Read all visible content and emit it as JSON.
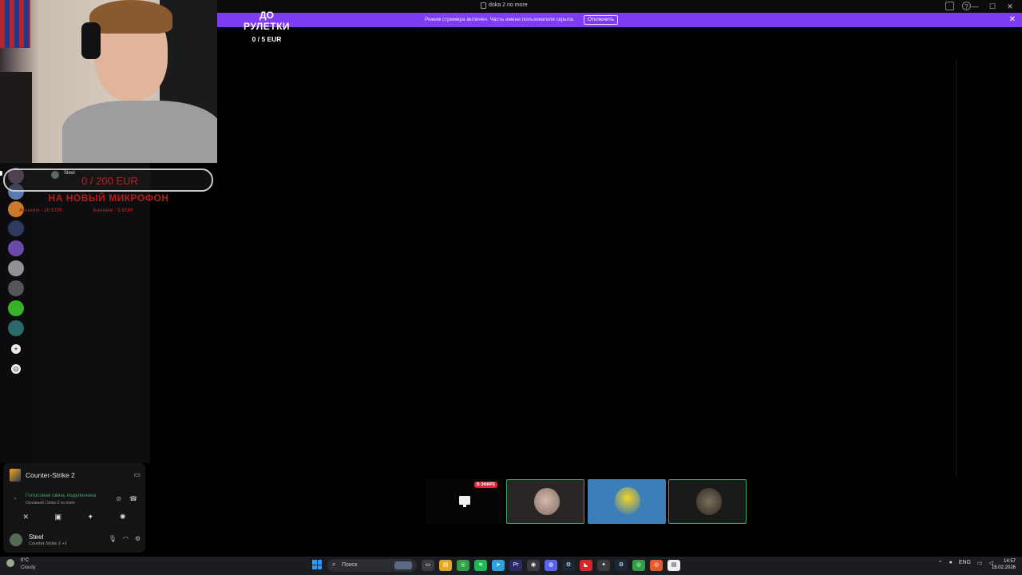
{
  "window": {
    "title": "doka 2 no more",
    "controls": [
      "—",
      "☐",
      "✕"
    ]
  },
  "banner": {
    "text": "Режим стримера включен. Часть имени пользователя скрыта.",
    "button": "Отключить",
    "close": "✕"
  },
  "goal": {
    "line1": "ДО",
    "line2": "РУЛЕТКИ",
    "line3": "0 / 5 EUR"
  },
  "donation": {
    "bar_text": "0 / 200 EUR",
    "chip_name": "Steel",
    "title": "НА НОВЫЙ МИКРОФОН",
    "sub1": "Аноним - 10 EUR",
    "sub2": "Аноним - 5 EUR"
  },
  "game": {
    "name": "Counter-Strike 2"
  },
  "voice": {
    "status": "Голосовая связь подключена",
    "sub": "Основной / doka 2 no more"
  },
  "user": {
    "name": "Steel",
    "status": "Counter-Strike 2 +1"
  },
  "tiles": {
    "live_label": "В ЭФИРЕ"
  },
  "taskbar": {
    "weather_temp": "0°C",
    "weather_cond": "Cloudy",
    "search_placeholder": "Поиск",
    "lang": "ENG",
    "time": "14:57",
    "date": "18.02.2026"
  },
  "colors": {
    "banner": "#7f3cf4",
    "voice_green": "#3ba55d",
    "donation_red": "#b51d1d",
    "live_red": "#e0243d"
  }
}
